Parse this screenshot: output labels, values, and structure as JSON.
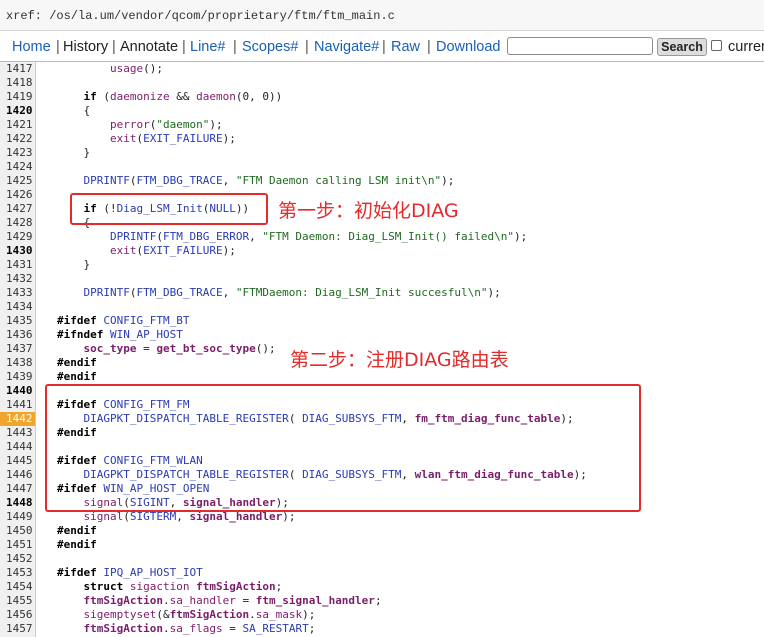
{
  "xref_path": "xref: /os/la.um/vendor/qcom/proprietary/ftm/ftm_main.c",
  "toolbar": {
    "home": "Home",
    "history": "History",
    "annotate": "Annotate",
    "line": "Line#",
    "scopes": "Scopes#",
    "navigate": "Navigate#",
    "raw": "Raw",
    "download": "Download",
    "search_value": "",
    "search_button": "Search",
    "current": "current"
  },
  "annotations": {
    "step1": "第一步：初始化DIAG",
    "step2": "第二步：注册DIAG路由表"
  },
  "colors": {
    "annotation": "#e32b2b",
    "highlight_line": "#f2a52c",
    "link": "#1a5fb4"
  },
  "highlighted_line": "1442",
  "lines": [
    {
      "n": "1417",
      "b": false,
      "segs": [
        [
          "",
          "        "
        ],
        [
          "f",
          "usage"
        ],
        [
          "",
          "();"
        ]
      ]
    },
    {
      "n": "1418",
      "b": false,
      "segs": []
    },
    {
      "n": "1419",
      "b": false,
      "segs": [
        [
          "",
          "    "
        ],
        [
          "k",
          "if"
        ],
        [
          "",
          " ("
        ],
        [
          "f",
          "daemonize"
        ],
        [
          "",
          " && "
        ],
        [
          "f",
          "daemon"
        ],
        [
          "",
          "(0, 0))"
        ]
      ]
    },
    {
      "n": "1420",
      "b": true,
      "segs": [
        [
          "",
          "    {"
        ]
      ]
    },
    {
      "n": "1421",
      "b": false,
      "segs": [
        [
          "",
          "        "
        ],
        [
          "f",
          "perror"
        ],
        [
          "",
          "("
        ],
        [
          "s",
          "\"daemon\""
        ],
        [
          "",
          ");"
        ]
      ]
    },
    {
      "n": "1422",
      "b": false,
      "segs": [
        [
          "",
          "        "
        ],
        [
          "f",
          "exit"
        ],
        [
          "",
          "("
        ],
        [
          "m",
          "EXIT_FAILURE"
        ],
        [
          "",
          ");"
        ]
      ]
    },
    {
      "n": "1423",
      "b": false,
      "segs": [
        [
          "",
          "    }"
        ]
      ]
    },
    {
      "n": "1424",
      "b": false,
      "segs": []
    },
    {
      "n": "1425",
      "b": false,
      "segs": [
        [
          "",
          "    "
        ],
        [
          "m",
          "DPRINTF"
        ],
        [
          "",
          "("
        ],
        [
          "m",
          "FTM_DBG_TRACE"
        ],
        [
          "",
          ", "
        ],
        [
          "s",
          "\"FTM Daemon calling LSM init\\n\""
        ],
        [
          "",
          ");"
        ]
      ]
    },
    {
      "n": "1426",
      "b": false,
      "segs": []
    },
    {
      "n": "1427",
      "b": false,
      "segs": [
        [
          "",
          "    "
        ],
        [
          "k",
          "if"
        ],
        [
          "",
          " (!"
        ],
        [
          "m",
          "Diag_LSM_Init"
        ],
        [
          "",
          "("
        ],
        [
          "m",
          "NULL"
        ],
        [
          "",
          "))"
        ]
      ]
    },
    {
      "n": "1428",
      "b": false,
      "segs": [
        [
          "",
          "    {"
        ]
      ]
    },
    {
      "n": "1429",
      "b": false,
      "segs": [
        [
          "",
          "        "
        ],
        [
          "m",
          "DPRINTF"
        ],
        [
          "",
          "("
        ],
        [
          "m",
          "FTM_DBG_ERROR"
        ],
        [
          "",
          ", "
        ],
        [
          "s",
          "\"FTM Daemon: Diag_LSM_Init() failed\\n\""
        ],
        [
          "",
          ");"
        ]
      ]
    },
    {
      "n": "1430",
      "b": true,
      "segs": [
        [
          "",
          "        "
        ],
        [
          "f",
          "exit"
        ],
        [
          "",
          "("
        ],
        [
          "m",
          "EXIT_FAILURE"
        ],
        [
          "",
          ");"
        ]
      ]
    },
    {
      "n": "1431",
      "b": false,
      "segs": [
        [
          "",
          "    }"
        ]
      ]
    },
    {
      "n": "1432",
      "b": false,
      "segs": []
    },
    {
      "n": "1433",
      "b": false,
      "segs": [
        [
          "",
          "    "
        ],
        [
          "m",
          "DPRINTF"
        ],
        [
          "",
          "("
        ],
        [
          "m",
          "FTM_DBG_TRACE"
        ],
        [
          "",
          ", "
        ],
        [
          "s",
          "\"FTMDaemon: Diag_LSM_Init succesful\\n\""
        ],
        [
          "",
          ");"
        ]
      ]
    },
    {
      "n": "1434",
      "b": false,
      "segs": []
    },
    {
      "n": "1435",
      "b": false,
      "segs": [
        [
          "k",
          "#ifdef"
        ],
        [
          "",
          " "
        ],
        [
          "m",
          "CONFIG_FTM_BT"
        ]
      ]
    },
    {
      "n": "1436",
      "b": false,
      "segs": [
        [
          "k",
          "#ifndef"
        ],
        [
          "",
          " "
        ],
        [
          "m",
          "WIN_AP_HOST"
        ]
      ]
    },
    {
      "n": "1437",
      "b": false,
      "segs": [
        [
          "",
          "    "
        ],
        [
          "fb",
          "soc_type"
        ],
        [
          "",
          " = "
        ],
        [
          "fb",
          "get_bt_soc_type"
        ],
        [
          "",
          "();"
        ]
      ]
    },
    {
      "n": "1438",
      "b": false,
      "segs": [
        [
          "k",
          "#endif"
        ]
      ]
    },
    {
      "n": "1439",
      "b": false,
      "segs": [
        [
          "k",
          "#endif"
        ]
      ]
    },
    {
      "n": "1440",
      "b": true,
      "segs": []
    },
    {
      "n": "1441",
      "b": false,
      "segs": [
        [
          "k",
          "#ifdef"
        ],
        [
          "",
          " "
        ],
        [
          "m",
          "CONFIG_FTM_FM"
        ]
      ]
    },
    {
      "n": "1442",
      "b": false,
      "segs": [
        [
          "",
          "    "
        ],
        [
          "m",
          "DIAGPKT_DISPATCH_TABLE_REGISTER"
        ],
        [
          "",
          "( "
        ],
        [
          "m",
          "DIAG_SUBSYS_FTM"
        ],
        [
          "",
          ", "
        ],
        [
          "fb",
          "fm_ftm_diag_func_table"
        ],
        [
          "",
          ");"
        ]
      ]
    },
    {
      "n": "1443",
      "b": false,
      "segs": [
        [
          "k",
          "#endif"
        ]
      ]
    },
    {
      "n": "1444",
      "b": false,
      "segs": []
    },
    {
      "n": "1445",
      "b": false,
      "segs": [
        [
          "k",
          "#ifdef"
        ],
        [
          "",
          " "
        ],
        [
          "m",
          "CONFIG_FTM_WLAN"
        ]
      ]
    },
    {
      "n": "1446",
      "b": false,
      "segs": [
        [
          "",
          "    "
        ],
        [
          "m",
          "DIAGPKT_DISPATCH_TABLE_REGISTER"
        ],
        [
          "",
          "( "
        ],
        [
          "m",
          "DIAG_SUBSYS_FTM"
        ],
        [
          "",
          ", "
        ],
        [
          "fb",
          "wlan_ftm_diag_func_table"
        ],
        [
          "",
          ");"
        ]
      ]
    },
    {
      "n": "1447",
      "b": false,
      "segs": [
        [
          "k",
          "#ifdef"
        ],
        [
          "",
          " "
        ],
        [
          "m",
          "WIN_AP_HOST_OPEN"
        ]
      ]
    },
    {
      "n": "1448",
      "b": true,
      "segs": [
        [
          "",
          "    "
        ],
        [
          "f",
          "signal"
        ],
        [
          "",
          "("
        ],
        [
          "m",
          "SIGINT"
        ],
        [
          "",
          ", "
        ],
        [
          "fb",
          "signal_handler"
        ],
        [
          "",
          ");"
        ]
      ]
    },
    {
      "n": "1449",
      "b": false,
      "segs": [
        [
          "",
          "    "
        ],
        [
          "f",
          "signal"
        ],
        [
          "",
          "("
        ],
        [
          "m",
          "SIGTERM"
        ],
        [
          "",
          ", "
        ],
        [
          "fb",
          "signal_handler"
        ],
        [
          "",
          ");"
        ]
      ]
    },
    {
      "n": "1450",
      "b": false,
      "segs": [
        [
          "k",
          "#endif"
        ]
      ]
    },
    {
      "n": "1451",
      "b": false,
      "segs": [
        [
          "k",
          "#endif"
        ]
      ]
    },
    {
      "n": "1452",
      "b": false,
      "segs": []
    },
    {
      "n": "1453",
      "b": false,
      "segs": [
        [
          "k",
          "#ifdef"
        ],
        [
          "",
          " "
        ],
        [
          "m",
          "IPQ_AP_HOST_IOT"
        ]
      ]
    },
    {
      "n": "1454",
      "b": false,
      "segs": [
        [
          "",
          "    "
        ],
        [
          "k",
          "struct"
        ],
        [
          "",
          " "
        ],
        [
          "f",
          "sigaction"
        ],
        [
          "",
          " "
        ],
        [
          "fb",
          "ftmSigAction"
        ],
        [
          "",
          ";"
        ]
      ]
    },
    {
      "n": "1455",
      "b": false,
      "segs": [
        [
          "",
          "    "
        ],
        [
          "fb",
          "ftmSigAction"
        ],
        [
          "",
          "."
        ],
        [
          "f",
          "sa_handler"
        ],
        [
          "",
          " = "
        ],
        [
          "fb",
          "ftm_signal_handler"
        ],
        [
          "",
          ";"
        ]
      ]
    },
    {
      "n": "1456",
      "b": false,
      "segs": [
        [
          "",
          "    "
        ],
        [
          "f",
          "sigemptyset"
        ],
        [
          "",
          "(&"
        ],
        [
          "fb",
          "ftmSigAction"
        ],
        [
          "",
          "."
        ],
        [
          "f",
          "sa_mask"
        ],
        [
          "",
          ");"
        ]
      ]
    },
    {
      "n": "1457",
      "b": false,
      "segs": [
        [
          "",
          "    "
        ],
        [
          "fb",
          "ftmSigAction"
        ],
        [
          "",
          "."
        ],
        [
          "f",
          "sa_flags"
        ],
        [
          "",
          " = "
        ],
        [
          "m",
          "SA_RESTART"
        ],
        [
          "",
          ";"
        ]
      ]
    }
  ]
}
